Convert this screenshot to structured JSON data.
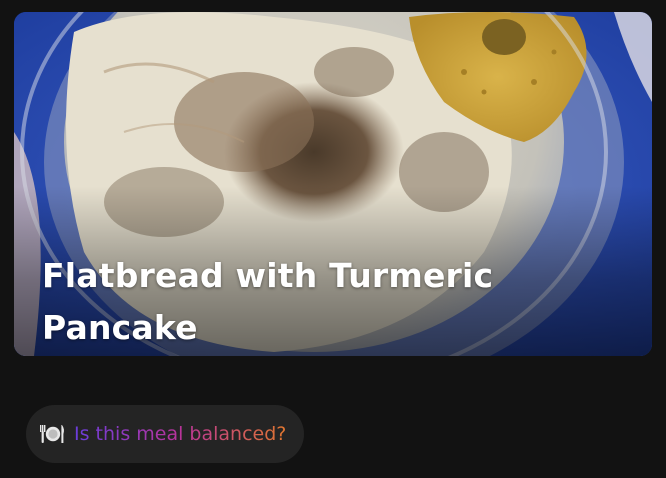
{
  "hero": {
    "title": "Flatbread with Turmeric Pancake"
  },
  "balance_prompt": {
    "icon": "plate-cutlery-icon",
    "label": "Is this meal balanced?",
    "gradient_colors": [
      "#6a3ddb",
      "#b8349a",
      "#e0762f"
    ]
  }
}
